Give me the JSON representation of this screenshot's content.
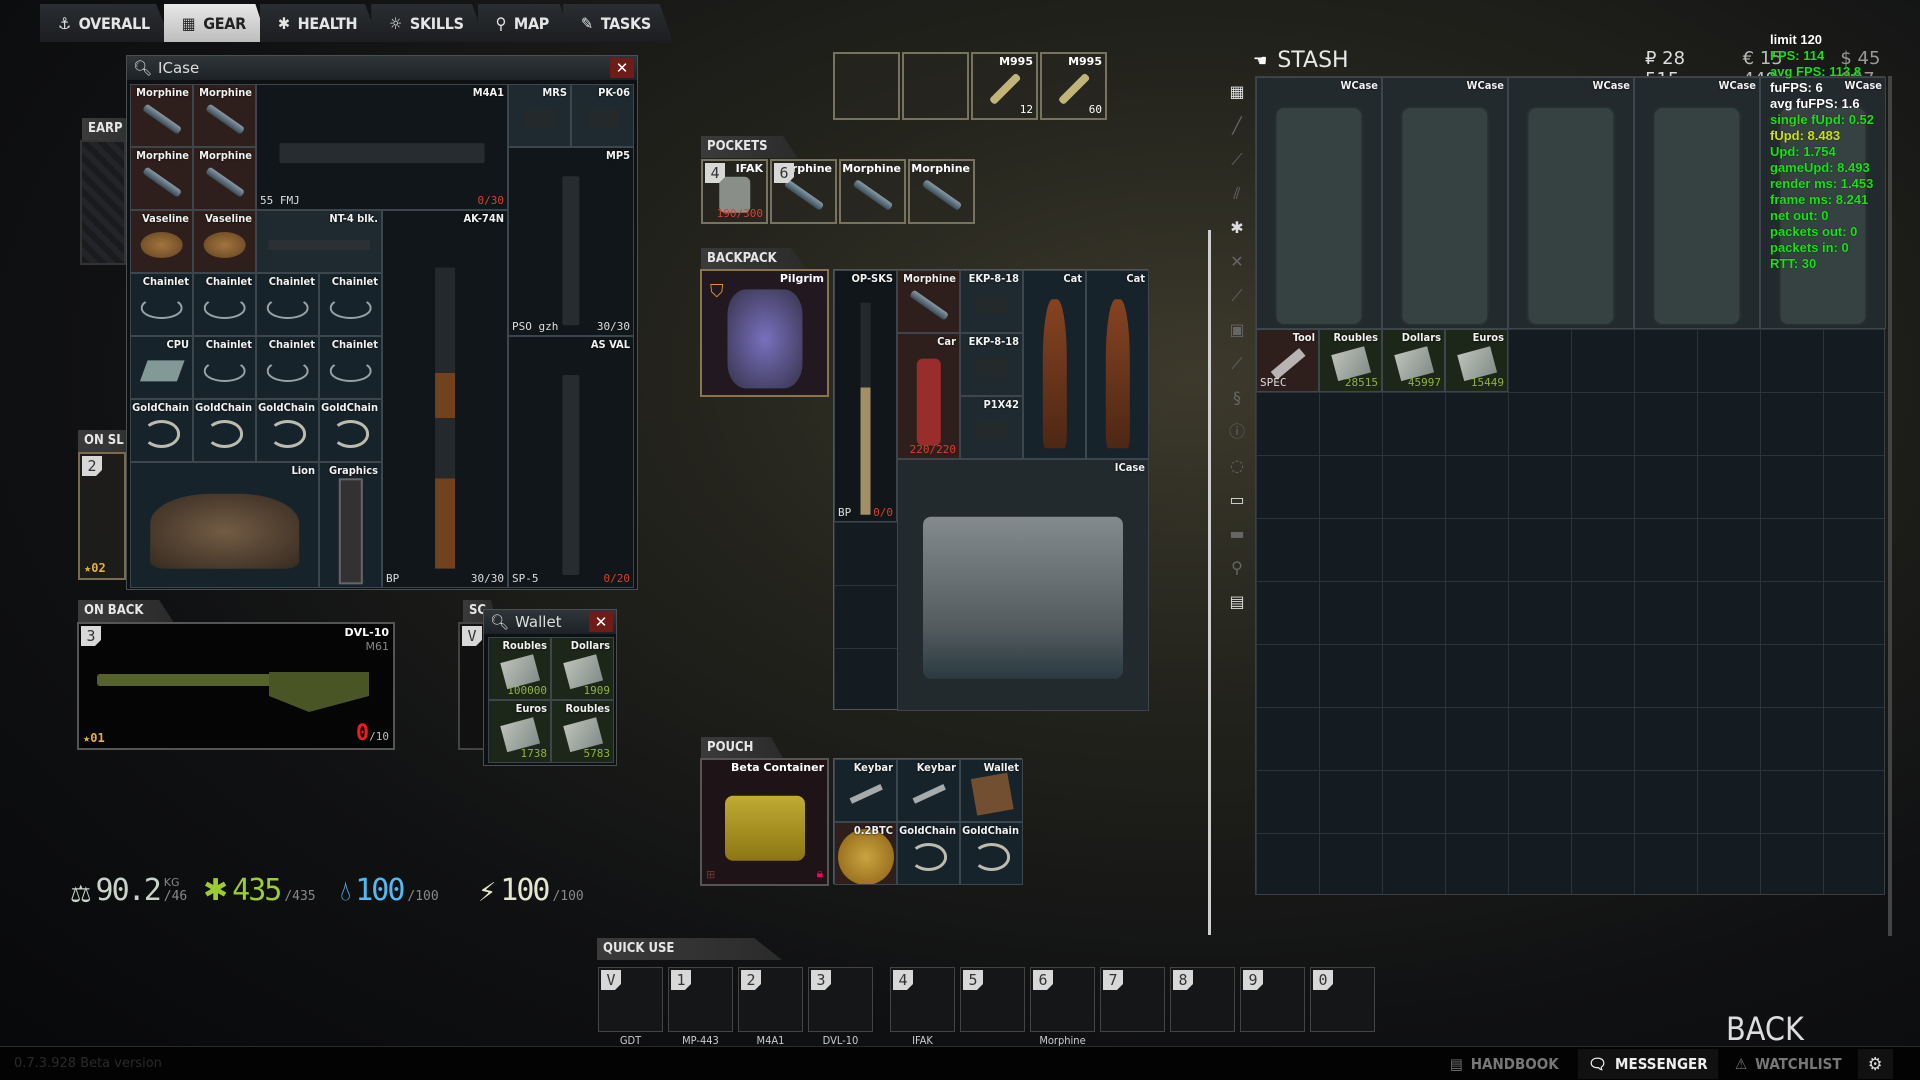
{
  "tabs": [
    {
      "label": "OVERALL",
      "icon": "person-info-icon",
      "glyph": "⚓"
    },
    {
      "label": "GEAR",
      "icon": "gear-vest-icon",
      "glyph": "▦",
      "active": true
    },
    {
      "label": "HEALTH",
      "icon": "health-asterisk-icon",
      "glyph": "✱"
    },
    {
      "label": "SKILLS",
      "icon": "lightbulb-icon",
      "glyph": "☼"
    },
    {
      "label": "MAP",
      "icon": "map-pin-icon",
      "glyph": "⚲"
    },
    {
      "label": "TASKS",
      "icon": "clipboard-icon",
      "glyph": "✎"
    }
  ],
  "icase_window": {
    "title": "ICase",
    "close": "✕",
    "items": [
      {
        "name": "Morphine",
        "tint": "meds",
        "icon": "morphine"
      },
      {
        "name": "Morphine",
        "tint": "meds",
        "icon": "morphine"
      },
      {
        "name": "Morphine",
        "tint": "meds",
        "icon": "morphine"
      },
      {
        "name": "Morphine",
        "tint": "meds",
        "icon": "morphine"
      },
      {
        "name": "M4A1",
        "sub": "55 FMJ",
        "count": "0/30",
        "count_color": "red",
        "tint": "weapon",
        "icon": "gun"
      },
      {
        "name": "MRS",
        "tint": "mod",
        "icon": "scope"
      },
      {
        "name": "PK-06",
        "tint": "mod",
        "icon": "scope"
      },
      {
        "name": "MP5",
        "sub": "PSO gzh",
        "count": "30/30",
        "tint": "weapon",
        "icon": "gunv"
      },
      {
        "name": "Vaseline",
        "tint": "meds",
        "icon": "vaseline"
      },
      {
        "name": "Vaseline",
        "tint": "meds",
        "icon": "vaseline"
      },
      {
        "name": "NT-4 blk.",
        "tint": "mod",
        "icon": "gun"
      },
      {
        "name": "AK-74N",
        "sub": "BP",
        "count": "30/30",
        "tint": "weapon",
        "icon": "ak"
      },
      {
        "name": "Chainlet",
        "tint": "barter",
        "icon": "chain"
      },
      {
        "name": "Chainlet",
        "tint": "barter",
        "icon": "chain"
      },
      {
        "name": "Chainlet",
        "tint": "barter",
        "icon": "chain"
      },
      {
        "name": "Chainlet",
        "tint": "barter",
        "icon": "chain"
      },
      {
        "name": "CPU",
        "tint": "barter",
        "icon": "cpu"
      },
      {
        "name": "Chainlet",
        "tint": "barter",
        "icon": "chain"
      },
      {
        "name": "Chainlet",
        "tint": "barter",
        "icon": "chain"
      },
      {
        "name": "Chainlet",
        "tint": "barter",
        "icon": "chain"
      },
      {
        "name": "GoldChain",
        "tint": "barter",
        "icon": "gold"
      },
      {
        "name": "GoldChain",
        "tint": "barter",
        "icon": "gold"
      },
      {
        "name": "GoldChain",
        "tint": "barter",
        "icon": "gold"
      },
      {
        "name": "GoldChain",
        "tint": "barter",
        "icon": "gold"
      },
      {
        "name": "Lion",
        "tint": "barter",
        "icon": "lion"
      },
      {
        "name": "Graphics",
        "tint": "barter",
        "icon": "gpu"
      },
      {
        "name": "AS VAL",
        "sub": "SP-5",
        "count": "0/20",
        "count_color": "red",
        "tint": "weapon",
        "icon": "gunv"
      }
    ]
  },
  "left_slots": {
    "earpiece_label": "EARP",
    "on_sling_label": "ON SL",
    "on_sling_key": "2",
    "on_sling_rank": "02"
  },
  "on_back": {
    "label": "ON BACK",
    "key": "3",
    "name": "DVL-10",
    "ammo": "M61",
    "count": "0",
    "capacity": "/10",
    "rank": "01"
  },
  "scabbard": {
    "label": "SC",
    "key": "V"
  },
  "wallet_window": {
    "title": "Wallet",
    "close": "✕",
    "items": [
      {
        "name": "Roubles",
        "count": "100000",
        "count_color": "green",
        "tint": "money",
        "icon": "money"
      },
      {
        "name": "Dollars",
        "count": "1909",
        "count_color": "green",
        "tint": "money",
        "icon": "money"
      },
      {
        "name": "Euros",
        "count": "1738",
        "count_color": "green",
        "tint": "money",
        "icon": "money"
      },
      {
        "name": "Roubles",
        "count": "5783",
        "count_color": "green",
        "tint": "money",
        "icon": "money"
      }
    ]
  },
  "stats": {
    "weight": {
      "value": "90.2",
      "unit": "KG",
      "max": "/46",
      "color": "#c9d3c7",
      "icon": "weight-icon"
    },
    "health": {
      "value": "435",
      "max": "/435",
      "color": "#9acd32",
      "icon": "health-icon"
    },
    "hydration": {
      "value": "100",
      "max": "/100",
      "color": "#55b8ef",
      "icon": "water-drop-icon"
    },
    "energy": {
      "value": "100",
      "max": "/100",
      "color": "#e6e6cf",
      "icon": "lightning-icon"
    }
  },
  "rig_slots": [
    {
      "name": "",
      "count": ""
    },
    {
      "name": "",
      "count": ""
    },
    {
      "name": "M995",
      "count": "12"
    },
    {
      "name": "M995",
      "count": "60"
    }
  ],
  "pockets": {
    "label": "POCKETS",
    "items": [
      {
        "name": "IFAK",
        "key": "4",
        "count": "190/300",
        "count_color": "red",
        "icon": "ifak"
      },
      {
        "name": "Morphine",
        "key": "6",
        "icon": "morphine"
      },
      {
        "name": "Morphine",
        "icon": "morphine"
      },
      {
        "name": "Morphine",
        "icon": "morphine"
      }
    ]
  },
  "backpack": {
    "label": "BACKPACK",
    "equipped": "Pilgrim",
    "items": [
      {
        "name": "OP-SKS",
        "sub": "BP",
        "count": "0/0",
        "count_color": "red",
        "tint": "weapon",
        "icon": "sks"
      },
      {
        "name": "Morphine",
        "tint": "meds",
        "icon": "morphine"
      },
      {
        "name": "EKP-8-18",
        "tint": "mod",
        "icon": "scope"
      },
      {
        "name": "Cat",
        "tint": "barter",
        "icon": "cat"
      },
      {
        "name": "Cat",
        "tint": "barter",
        "icon": "cat"
      },
      {
        "name": "Car",
        "count": "220/220",
        "count_color": "red",
        "tint": "meds",
        "icon": "med"
      },
      {
        "name": "EKP-8-18",
        "tint": "mod",
        "icon": "scope"
      },
      {
        "name": "P1X42",
        "tint": "mod",
        "icon": "scope"
      },
      {
        "name": "ICase",
        "tint": "container",
        "icon": "case"
      }
    ]
  },
  "pouch": {
    "label": "POUCH",
    "equipped": "Beta Container",
    "items": [
      {
        "name": "Keybar",
        "tint": "barter",
        "icon": "key"
      },
      {
        "name": "Keybar",
        "tint": "barter",
        "icon": "key"
      },
      {
        "name": "Wallet",
        "tint": "barter",
        "icon": "wallet"
      },
      {
        "name": "0.2BTC",
        "tint": "meds",
        "icon": "coin"
      },
      {
        "name": "GoldChain",
        "tint": "barter",
        "icon": "gold"
      },
      {
        "name": "GoldChain",
        "tint": "barter",
        "icon": "gold"
      }
    ]
  },
  "stash": {
    "title": "STASH",
    "roubles": "₽ 28 515",
    "euros": "€ 15 449",
    "dollars": "$ 45 997",
    "sidebar_icons": [
      "grid-icon",
      "weapon-icon",
      "knife-icon",
      "ammo-icon",
      "medical-icon",
      "mods-icon",
      "armor-icon",
      "barter-icon",
      "food-icon",
      "keys-icon",
      "info-icon",
      "container-icon",
      "backpack-icon",
      "book-icon",
      "wrench-icon",
      "notes-icon"
    ],
    "items": [
      {
        "name": "WCase",
        "tint": "container",
        "icon": "wcase"
      },
      {
        "name": "WCase",
        "tint": "container",
        "icon": "wcase"
      },
      {
        "name": "WCase",
        "tint": "container",
        "icon": "wcase"
      },
      {
        "name": "WCase",
        "tint": "container",
        "icon": "wcase"
      },
      {
        "name": "WCase",
        "tint": "container",
        "icon": "wcase"
      },
      {
        "name": "Tool",
        "sub": "SPEC",
        "tint": "meds",
        "icon": "tool"
      },
      {
        "name": "Roubles",
        "count": "28515",
        "count_color": "green",
        "tint": "money",
        "icon": "money"
      },
      {
        "name": "Dollars",
        "count": "45997",
        "count_color": "green",
        "tint": "money",
        "icon": "money"
      },
      {
        "name": "Euros",
        "count": "15449",
        "count_color": "green",
        "tint": "money",
        "icon": "money"
      }
    ]
  },
  "debug": [
    {
      "text": "limit 120",
      "color": "w"
    },
    {
      "text": "FPS: 114",
      "color": "g"
    },
    {
      "text": "avg FPS: 113.8",
      "color": "g"
    },
    {
      "text": "fuFPS: 6",
      "color": "w"
    },
    {
      "text": "avg fuFPS: 1.6",
      "color": "w"
    },
    {
      "text": "single fUpd: 0.52",
      "color": "g"
    },
    {
      "text": "fUpd: 8.483",
      "color": "y"
    },
    {
      "text": "Upd: 1.754",
      "color": "g"
    },
    {
      "text": "gameUpd: 8.493",
      "color": "g"
    },
    {
      "text": "render ms: 1.453",
      "color": "g"
    },
    {
      "text": "frame ms: 8.241",
      "color": "g"
    },
    {
      "text": "net out: 0",
      "color": "g"
    },
    {
      "text": "packets out: 0",
      "color": "g"
    },
    {
      "text": "packets in: 0",
      "color": "g"
    },
    {
      "text": "RTT: 30",
      "color": "g"
    }
  ],
  "quick_use": {
    "label": "QUICK USE",
    "slots": [
      {
        "key": "V",
        "label": "GDT"
      },
      {
        "key": "1",
        "label": "MP-443"
      },
      {
        "key": "2",
        "label": "M4A1"
      },
      {
        "key": "3",
        "label": "DVL-10"
      },
      {
        "key": "4",
        "label": "IFAK"
      },
      {
        "key": "5",
        "label": ""
      },
      {
        "key": "6",
        "label": "Morphine"
      },
      {
        "key": "7",
        "label": ""
      },
      {
        "key": "8",
        "label": ""
      },
      {
        "key": "9",
        "label": ""
      },
      {
        "key": "0",
        "label": ""
      }
    ]
  },
  "back_button": "BACK",
  "bottom_bar": {
    "handbook": "HANDBOOK",
    "messenger": "MESSENGER",
    "watchlist": "WATCHLIST"
  },
  "version": "0.7.3.928 Beta version"
}
